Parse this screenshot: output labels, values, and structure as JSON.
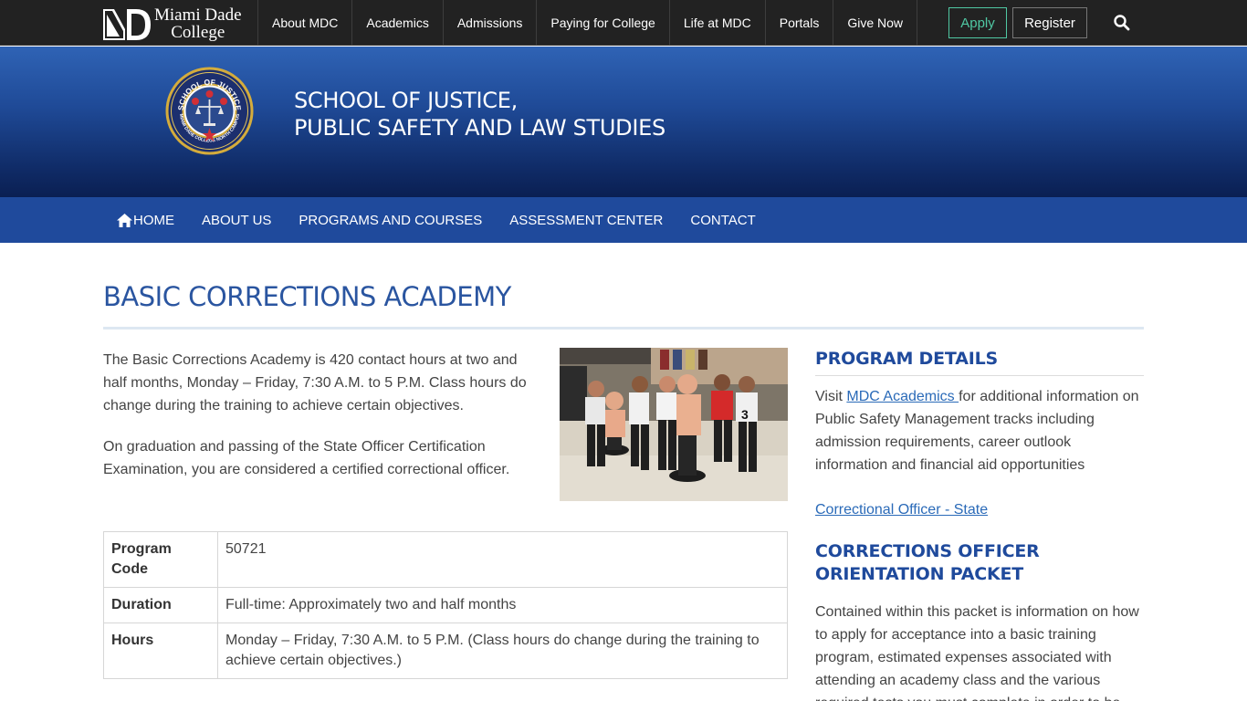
{
  "header": {
    "logo_line1": "Miami Dade",
    "logo_line2": "College",
    "nav": [
      "About MDC",
      "Academics",
      "Admissions",
      "Paying for College",
      "Life at MDC",
      "Portals",
      "Give Now"
    ],
    "apply_label": "Apply",
    "register_label": "Register",
    "search_icon": "search-icon"
  },
  "banner": {
    "seal_text_top": "SCHOOL OF JUSTICE",
    "seal_text_bottom": "MIAMI DADE COLLEGE NORTH CAMPUS",
    "title_line1": "SCHOOL OF JUSTICE,",
    "title_line2": "PUBLIC SAFETY AND LAW STUDIES"
  },
  "subnav": {
    "items": [
      "HOME",
      "ABOUT US",
      "PROGRAMS AND COURSES",
      "ASSESSMENT CENTER",
      "CONTACT"
    ],
    "home_icon": "home-icon"
  },
  "main": {
    "title": "BASIC CORRECTIONS ACADEMY",
    "intro_p1": "The Basic Corrections Academy is 420 contact hours at two and half months, Monday – Friday, 7:30 A.M. to 5 P.M. Class hours do change during the training to achieve certain objectives.",
    "intro_p2": "On graduation and passing of the State Officer Certification Examination, you are considered a certified correctional officer.",
    "table": [
      {
        "key": "Program Code",
        "value": "50721"
      },
      {
        "key": "Duration",
        "value": "Full-time: Approximately two and half months"
      },
      {
        "key": "Hours",
        "value": "Monday – Friday, 7:30 A.M. to 5 P.M. (Class hours do change during the training to achieve certain objectives.)"
      }
    ]
  },
  "sidebar": {
    "program_details_heading": "PROGRAM DETAILS",
    "visit_prefix": "Visit ",
    "mdc_academics_link": "MDC Academics ",
    "visit_suffix": "for additional information on Public Safety Management tracks including admission requirements, career outlook information and financial aid opportunities",
    "state_link": "Correctional Officer - State",
    "packet_heading_line1": "CORRECTIONS OFFICER",
    "packet_heading_line2": "ORIENTATION PACKET",
    "packet_text": "Contained within this packet is information on how to apply for acceptance into a basic training program, estimated expenses associated with attending an academy class and the various required tests you must complete in order to be"
  }
}
